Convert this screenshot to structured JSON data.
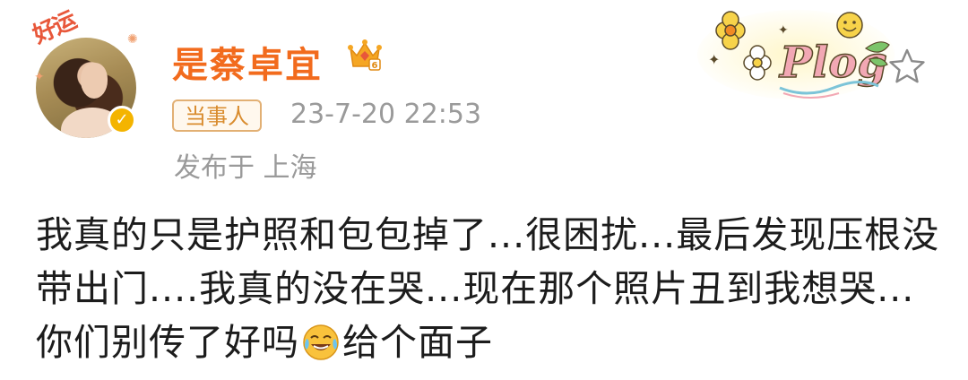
{
  "post": {
    "avatar_badge": "好运",
    "username": "是蔡卓宜",
    "tag": "当事人",
    "timestamp": "23-7-20 22:53",
    "location": "发布于 上海",
    "sticker_text": "Plog",
    "body_part1": "我真的只是护照和包包掉了...很困扰...最后发现压根没带出门....我真的没在哭...现在那个照片丑到我想哭...你们别传了好吗",
    "body_part2": "给个面子"
  },
  "icons": {
    "verified": "verified-check-icon",
    "crown": "crown-membership-icon",
    "star": "star-icon",
    "emoji": "crying-laughing-emoji-icon"
  },
  "colors": {
    "username": "#f26b1d",
    "tag_border": "#e2b074",
    "tag_text": "#d98c2e",
    "meta_text": "#9a9a9a",
    "body_text": "#1c1c1c",
    "verified": "#f4b400"
  }
}
